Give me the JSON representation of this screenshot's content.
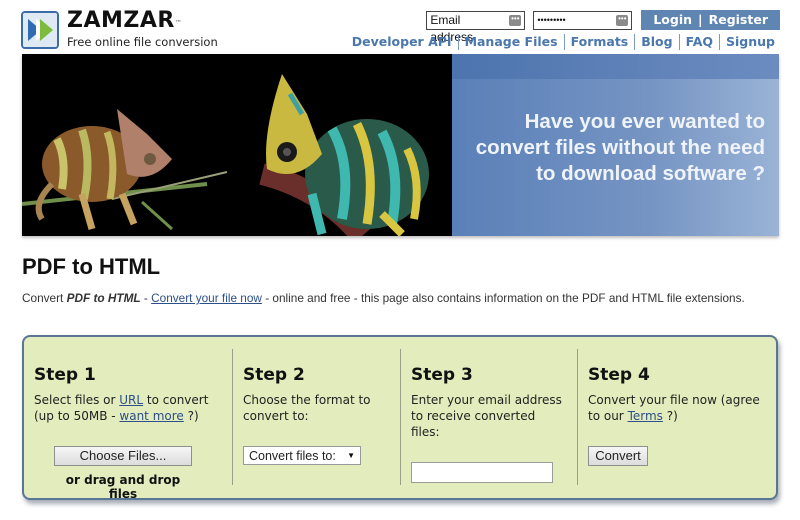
{
  "header": {
    "brand_name": "ZAMZAR",
    "trademark": "™",
    "tagline": "Free online file conversion",
    "email_placeholder": "Email address",
    "password_mask": "•••••••••",
    "login_label": "Login",
    "separator": "|",
    "register_label": "Register",
    "nav": [
      {
        "label": "Developer API"
      },
      {
        "label": "Manage Files"
      },
      {
        "label": "Formats"
      },
      {
        "label": "Blog"
      },
      {
        "label": "FAQ"
      },
      {
        "label": "Signup"
      }
    ]
  },
  "banner": {
    "lines": [
      "Have you ever wanted to",
      "convert files without the need",
      "to download software ?"
    ]
  },
  "page": {
    "title": "PDF to HTML",
    "intro_prefix": "Convert ",
    "intro_emphasis": "PDF to HTML",
    "intro_dash": " - ",
    "intro_link": "Convert your file now",
    "intro_suffix": " - online and free - this page also contains information on the PDF and HTML file extensions."
  },
  "steps": [
    {
      "title": "Step 1",
      "desc_a": "Select files or ",
      "link_url": "URL",
      "desc_b": " to convert",
      "desc_c": "(up to 50MB - ",
      "link_more": "want more",
      "desc_d": " ?)",
      "button": "Choose Files...",
      "drag_text": "or drag and drop files"
    },
    {
      "title": "Step 2",
      "desc": "Choose the format to convert to:",
      "select_value": "Convert files to:",
      "select_arrow": "▼"
    },
    {
      "title": "Step 3",
      "desc": "Enter your email address to receive converted files:",
      "input_value": ""
    },
    {
      "title": "Step 4",
      "desc_a": "Convert your file now (agree to our ",
      "link_terms": "Terms",
      "desc_b": " ?)",
      "button": "Convert"
    }
  ],
  "colors": {
    "brand_blue": "#4a77ad",
    "login_bg": "#5f85b3",
    "steps_bg": "#e2ecbd",
    "steps_border": "#5b7597",
    "link": "#2d4f8a"
  }
}
